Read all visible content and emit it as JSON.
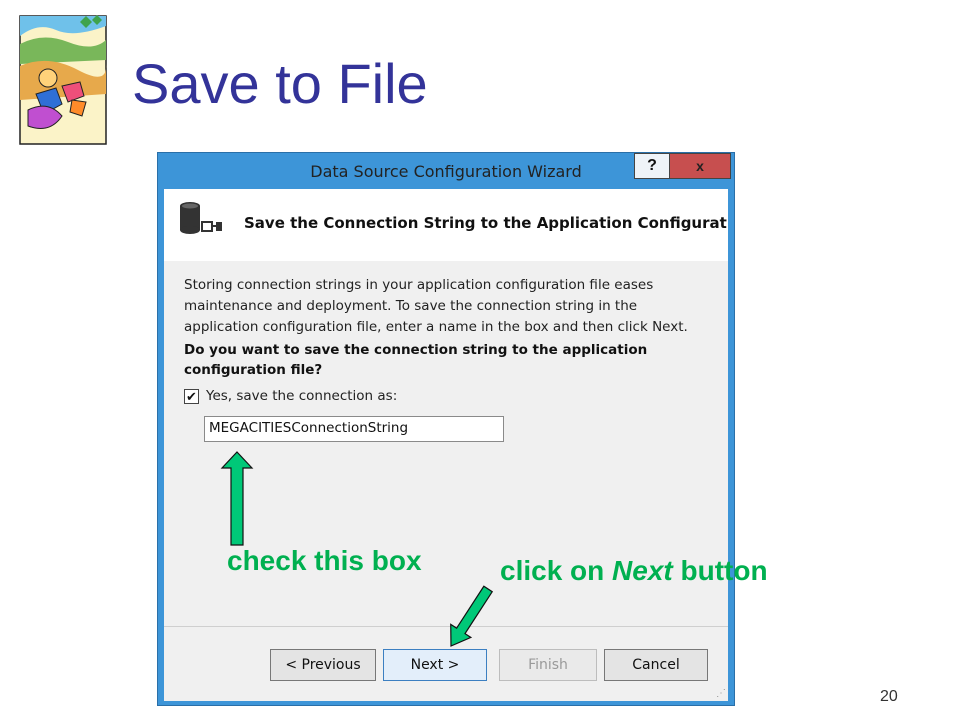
{
  "slide": {
    "title": "Save to File",
    "number": "20"
  },
  "wizard": {
    "title": "Data Source Configuration Wizard",
    "help_label": "?",
    "close_label": "x",
    "header": "Save the Connection String to the Application Configuration File",
    "description": "Storing connection strings in your application configuration file eases maintenance and deployment. To save the connection string in the application configuration file, enter a name in the box and then click Next.",
    "question": "Do you want to save the connection string to the application configuration file?",
    "checkbox_label": "Yes, save the connection as:",
    "checkbox_checked": true,
    "connection_name": "MEGACITIESConnectionString",
    "buttons": {
      "previous": "< Previous",
      "next": "Next >",
      "finish": "Finish",
      "cancel": "Cancel"
    }
  },
  "annotations": {
    "check_box": "check this box",
    "next_prefix": "click on ",
    "next_emph": "Next",
    "next_suffix": " button",
    "color": "#00b050"
  }
}
